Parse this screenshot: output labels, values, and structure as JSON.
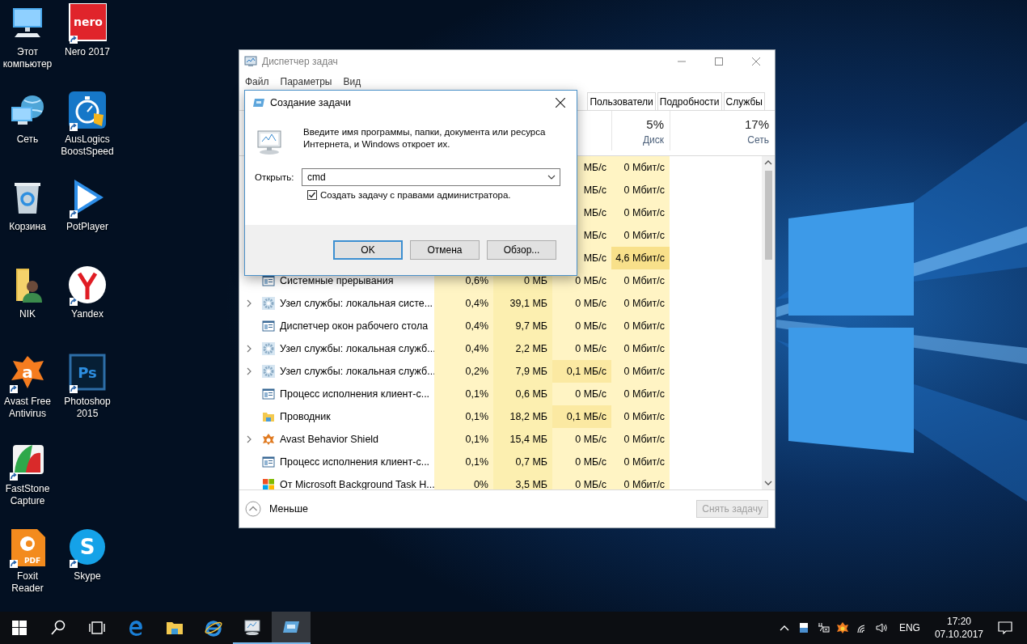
{
  "desktop_icons": [
    [
      {
        "label": "Этот компьютер",
        "kind": "computer",
        "shortcut": false
      },
      {
        "label": "Сеть",
        "kind": "network",
        "shortcut": false
      },
      {
        "label": "Корзина",
        "kind": "recycle-bin",
        "shortcut": false
      },
      {
        "label": "NIK",
        "kind": "user-folder",
        "shortcut": false
      },
      {
        "label": "Avast Free Antivirus",
        "kind": "avast",
        "glyph": "a",
        "shortcut": true
      },
      {
        "label": "FastStone Capture",
        "kind": "faststone",
        "shortcut": true
      },
      {
        "label": "Foxit Reader",
        "kind": "foxit",
        "glyph": "PDF",
        "shortcut": true
      }
    ],
    [
      {
        "label": "Nero 2017",
        "kind": "nero",
        "glyph": "nero",
        "shortcut": true
      },
      {
        "label": "AusLogics BoostSpeed",
        "kind": "stopwatch",
        "shortcut": true
      },
      {
        "label": "PotPlayer",
        "kind": "play",
        "shortcut": true
      },
      {
        "label": "Yandex",
        "kind": "yandex",
        "shortcut": true
      },
      {
        "label": "Photoshop 2015",
        "kind": "photoshop",
        "glyph": "Ps",
        "shortcut": true
      },
      {
        "label": "Skype",
        "kind": "skype",
        "glyph": "S",
        "shortcut": true,
        "skip_slot": true
      }
    ]
  ],
  "task_manager": {
    "title": "Диспетчер задач",
    "menu": [
      "Файл",
      "Параметры",
      "Вид"
    ],
    "tabs": [
      {
        "label": "Пользователи",
        "selected": false
      },
      {
        "label": "Подробности",
        "selected": false
      },
      {
        "label": "Службы",
        "selected": false
      }
    ],
    "columns": [
      {
        "percent": "5%",
        "label": "Диск"
      },
      {
        "percent": "17%",
        "label": "Сеть"
      }
    ],
    "rows": [
      {
        "disk": "МБ/с",
        "network": "0 Мбит/с",
        "disk_high": false,
        "network_high": false
      },
      {
        "disk": "МБ/с",
        "network": "0 Мбит/с",
        "disk_high": false,
        "network_high": false
      },
      {
        "disk": "МБ/с",
        "network": "0 Мбит/с",
        "disk_high": false,
        "network_high": false
      },
      {
        "disk": "МБ/с",
        "network": "0 Мбит/с",
        "disk_high": false,
        "network_high": false
      },
      {
        "disk": "МБ/с",
        "network": "4,6 Мбит/с",
        "disk_high": false,
        "network_high": true
      },
      {
        "name": "Системные прерывания",
        "kind": "window",
        "expandable": false,
        "cpu": "0,6%",
        "memory": "0 МБ",
        "disk": "0 МБ/с",
        "network": "0 Мбит/с",
        "disk_high": false,
        "network_high": false
      },
      {
        "name": "Узел службы: локальная систе...",
        "kind": "gear",
        "expandable": true,
        "cpu": "0,4%",
        "memory": "39,1 МБ",
        "disk": "0 МБ/с",
        "network": "0 Мбит/с",
        "disk_high": false,
        "network_high": false
      },
      {
        "name": "Диспетчер окон рабочего стола",
        "kind": "window",
        "expandable": false,
        "cpu": "0,4%",
        "memory": "9,7 МБ",
        "disk": "0 МБ/с",
        "network": "0 Мбит/с",
        "disk_high": false,
        "network_high": false
      },
      {
        "name": "Узел службы: локальная служб...",
        "kind": "gear",
        "expandable": true,
        "cpu": "0,4%",
        "memory": "2,2 МБ",
        "disk": "0 МБ/с",
        "network": "0 Мбит/с",
        "disk_high": false,
        "network_high": false
      },
      {
        "name": "Узел службы: локальная служб...",
        "kind": "gear",
        "expandable": true,
        "cpu": "0,2%",
        "memory": "7,9 МБ",
        "disk": "0,1 МБ/с",
        "network": "0 Мбит/с",
        "disk_high": true,
        "network_high": false
      },
      {
        "name": "Процесс исполнения клиент-с...",
        "kind": "window",
        "expandable": false,
        "cpu": "0,1%",
        "memory": "0,6 МБ",
        "disk": "0 МБ/с",
        "network": "0 Мбит/с",
        "disk_high": false,
        "network_high": false
      },
      {
        "name": "Проводник",
        "kind": "folder",
        "expandable": false,
        "cpu": "0,1%",
        "memory": "18,2 МБ",
        "disk": "0,1 МБ/с",
        "network": "0 Мбит/с",
        "disk_high": true,
        "network_high": false
      },
      {
        "name": "Avast Behavior Shield",
        "kind": "avast",
        "expandable": true,
        "cpu": "0,1%",
        "memory": "15,4 МБ",
        "disk": "0 МБ/с",
        "network": "0 Мбит/с",
        "disk_high": false,
        "network_high": false
      },
      {
        "name": "Процесс исполнения клиент-с...",
        "kind": "window",
        "expandable": false,
        "cpu": "0,1%",
        "memory": "0,7 МБ",
        "disk": "0 МБ/с",
        "network": "0 Мбит/с",
        "disk_high": false,
        "network_high": false
      },
      {
        "name": "От Microsoft Background Task H...",
        "kind": "tiles",
        "expandable": false,
        "cpu": "0%",
        "memory": "3,5 МБ",
        "disk": "0 МБ/с",
        "network": "0 Мбит/с",
        "disk_high": false,
        "network_high": false
      }
    ],
    "fewer_details": "Меньше",
    "end_task": {
      "label": "Снять задачу",
      "disabled": true
    }
  },
  "run_dialog": {
    "title": "Создание задачи",
    "message": "Введите имя программы, папки, документа или ресурса Интернета, и Windows откроет их.",
    "open_label": "Открыть:",
    "value": "cmd",
    "admin": {
      "label": "Создать задачу с правами администратора.",
      "checked": true
    },
    "buttons": [
      {
        "label": "OK",
        "default": true
      },
      {
        "label": "Отмена",
        "default": false
      },
      {
        "label": "Обзор...",
        "default": false
      }
    ]
  },
  "taskbar": {
    "items": [
      {
        "kind": "start",
        "running": false,
        "selected": false
      },
      {
        "kind": "search",
        "running": false,
        "selected": false
      },
      {
        "kind": "task-view",
        "running": false,
        "selected": false
      },
      {
        "kind": "edge",
        "running": false,
        "selected": false
      },
      {
        "kind": "explorer",
        "running": false,
        "selected": false
      },
      {
        "kind": "ie",
        "running": false,
        "selected": false
      },
      {
        "kind": "task-manager",
        "running": true,
        "selected": false
      },
      {
        "kind": "run",
        "running": true,
        "selected": true
      }
    ],
    "tray": [
      {
        "kind": "chevron"
      },
      {
        "kind": "battery"
      },
      {
        "kind": "power"
      },
      {
        "kind": "avast"
      },
      {
        "kind": "wifi"
      },
      {
        "kind": "volume"
      }
    ],
    "language": "ENG",
    "time": "17:20",
    "date": "07.10.2017"
  }
}
